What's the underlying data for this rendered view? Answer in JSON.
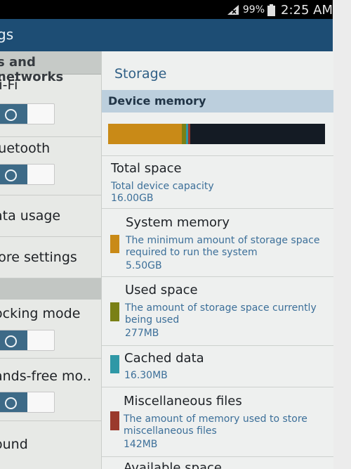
{
  "status_bar": {
    "battery_percent": "99%",
    "time": "2:25 AM",
    "icons": [
      "signal-icon",
      "battery-icon"
    ]
  },
  "action_bar": {
    "title": "gs"
  },
  "left_panel": {
    "section_header": "s and networks",
    "wifi_label": "/i-Fi",
    "bluetooth_label": "luetooth",
    "data_usage_label": "ata usage",
    "more_settings_label": "lore settings",
    "blocking_mode_label": "ocking mode",
    "hands_free_label": "ands-free mo..",
    "sound_label": "ound",
    "toggles": {
      "wifi": "on",
      "bluetooth": "on",
      "blocking_mode": "on",
      "hands_free": "on"
    }
  },
  "right_panel": {
    "title": "Storage",
    "section_header": "Device memory",
    "memory_bar": {
      "total_gb": 16.0,
      "segments": [
        {
          "name": "System memory",
          "gb": 5.5,
          "color": "#c98a17"
        },
        {
          "name": "Used space",
          "gb": 0.277,
          "color": "#7a8016"
        },
        {
          "name": "Cached data",
          "gb": 0.0163,
          "color": "#2f98a6"
        },
        {
          "name": "Miscellaneous files",
          "gb": 0.142,
          "color": "#9a3a2c"
        }
      ]
    },
    "total_space": {
      "title": "Total space",
      "desc": "Total device capacity",
      "value": "16.00GB"
    },
    "system_memory": {
      "title": "System memory",
      "desc": "The minimum amount of storage space required to run the system",
      "value": "5.50GB",
      "color": "#c98a17"
    },
    "used_space": {
      "title": "Used space",
      "desc": "The amount of storage space currently being used",
      "value": "277MB",
      "color": "#7a8016"
    },
    "cached_data": {
      "title": "Cached data",
      "value": "16.30MB",
      "color": "#2f98a6"
    },
    "misc_files": {
      "title": "Miscellaneous files",
      "desc": "The amount of memory used to store miscellaneous files",
      "value": "142MB",
      "color": "#9a3a2c"
    },
    "available_space": {
      "title": "Available space"
    }
  }
}
